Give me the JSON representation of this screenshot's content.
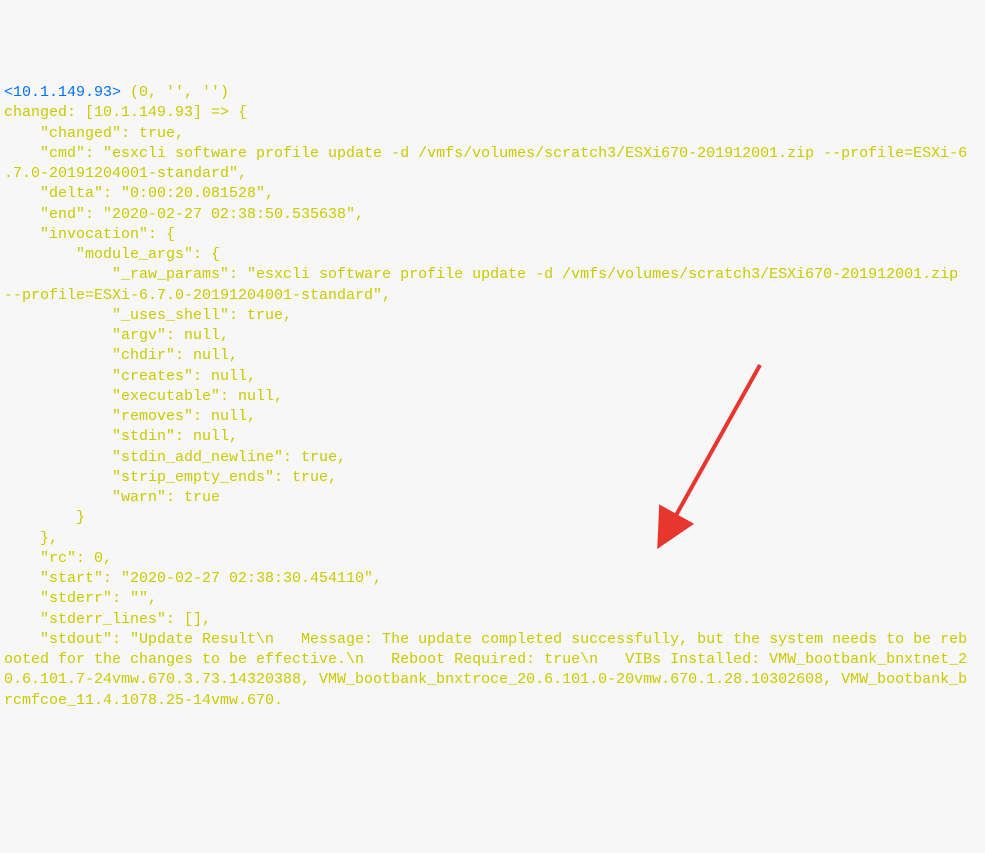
{
  "lines": {
    "l01a": "<10.1.149.93>",
    "l01b": " (0, '', '')",
    "l02": "changed: [10.1.149.93] => {",
    "l03": "    \"changed\": true,",
    "l04": "    \"cmd\": \"esxcli software profile update -d /vmfs/volumes/scratch3/ESXi670-201912001.zip --profile=ESXi-6.7.0-20191204001-standard\",",
    "l05": "    \"delta\": \"0:00:20.081528\",",
    "l06": "    \"end\": \"2020-02-27 02:38:50.535638\",",
    "l07": "    \"invocation\": {",
    "l08": "        \"module_args\": {",
    "l09": "            \"_raw_params\": \"esxcli software profile update -d /vmfs/volumes/scratch3/ESXi670-201912001.zip --profile=ESXi-6.7.0-20191204001-standard\",",
    "l10": "            \"_uses_shell\": true,",
    "l11": "            \"argv\": null,",
    "l12": "            \"chdir\": null,",
    "l13": "            \"creates\": null,",
    "l14": "            \"executable\": null,",
    "l15": "            \"removes\": null,",
    "l16": "            \"stdin\": null,",
    "l17": "            \"stdin_add_newline\": true,",
    "l18": "            \"strip_empty_ends\": true,",
    "l19": "            \"warn\": true",
    "l20": "        }",
    "l21": "    },",
    "l22": "    \"rc\": 0,",
    "l23": "    \"start\": \"2020-02-27 02:38:30.454110\",",
    "l24": "    \"stderr\": \"\",",
    "l25": "    \"stderr_lines\": [],",
    "l26": "    \"stdout\": \"Update Result\\n   Message: The update completed successfully, but the system needs to be rebooted for the changes to be effective.\\n   Reboot Required: true\\n   VIBs Installed: VMW_bootbank_bnxtnet_20.6.101.7-24vmw.670.3.73.14320388, VMW_bootbank_bnxtroce_20.6.101.0-20vmw.670.1.28.10302608, VMW_bootbank_brcmfcoe_11.4.1078.25-14vmw.670."
  }
}
